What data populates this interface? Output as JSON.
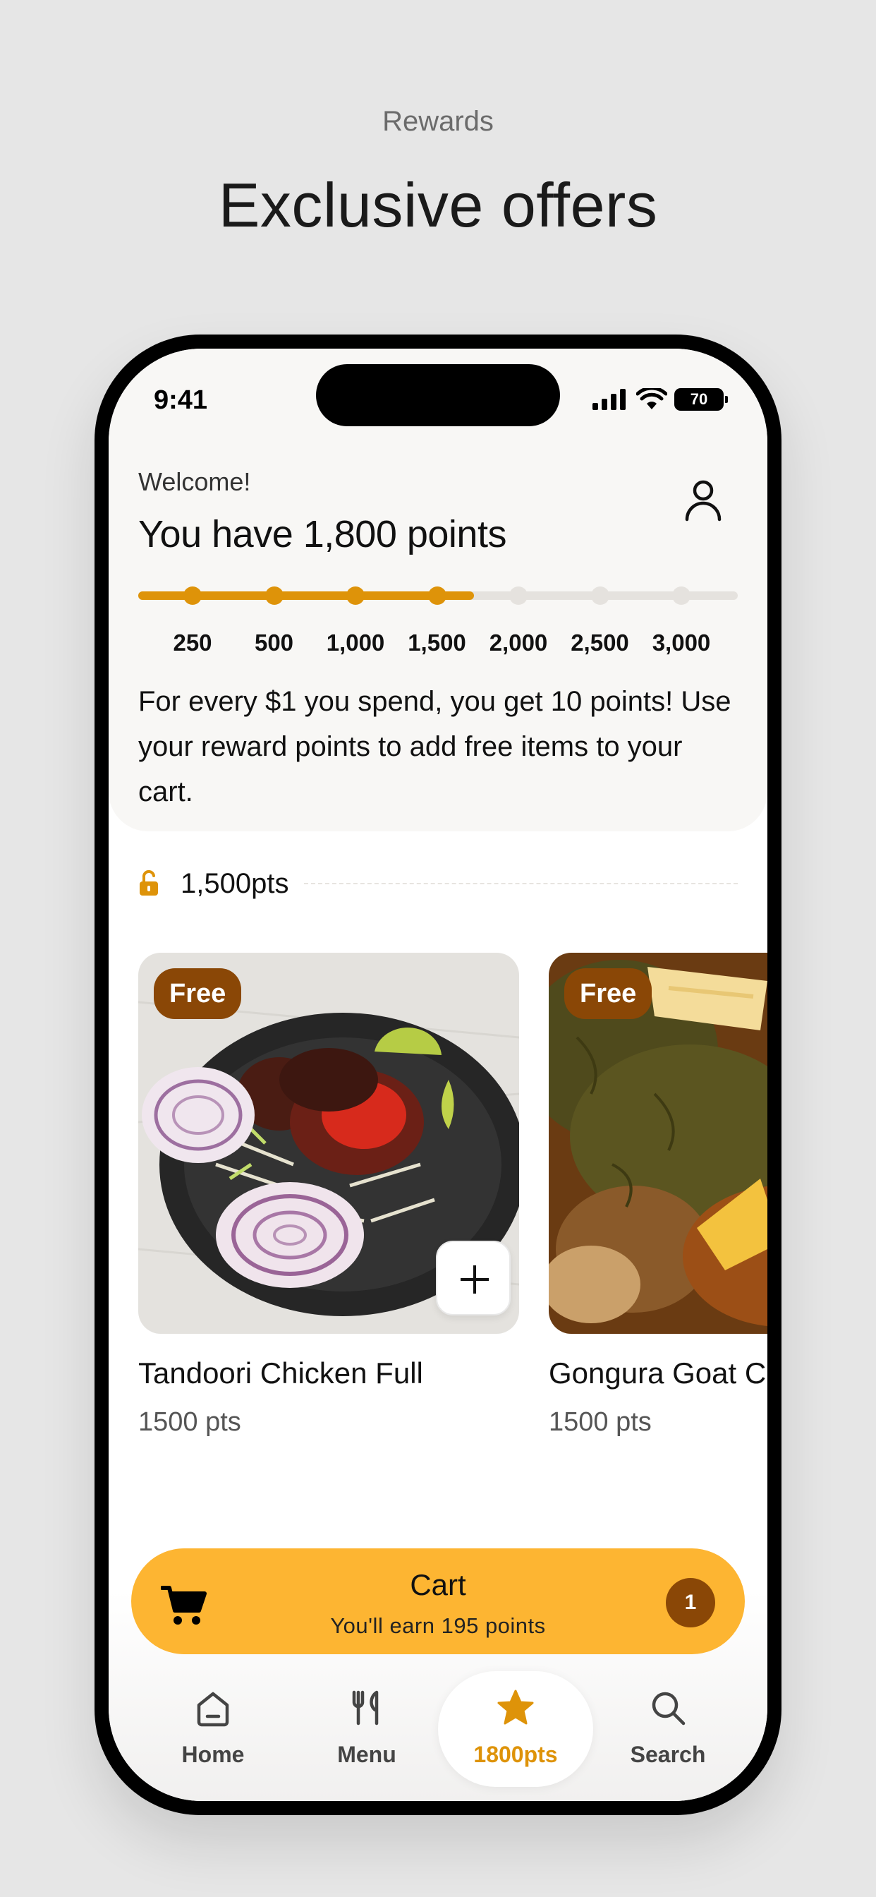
{
  "promo": {
    "eyebrow": "Rewards",
    "title": "Exclusive offers"
  },
  "status_bar": {
    "time": "9:41",
    "battery": "70",
    "icons": [
      "signal-icon",
      "wifi-icon",
      "battery-icon"
    ]
  },
  "header": {
    "welcome": "Welcome!",
    "points_title": "You have 1,800 points",
    "profile_icon": "person-icon"
  },
  "progress": {
    "current_points": 1800,
    "max_points": 3000,
    "fill_fraction": 0.56,
    "milestones": [
      {
        "label": "250",
        "reached": true
      },
      {
        "label": "500",
        "reached": true
      },
      {
        "label": "1,000",
        "reached": true
      },
      {
        "label": "1,500",
        "reached": true
      },
      {
        "label": "2,000",
        "reached": false
      },
      {
        "label": "2,500",
        "reached": false
      },
      {
        "label": "3,000",
        "reached": false
      }
    ]
  },
  "info_text": "For every $1 you spend, you get 10 points! Use your reward points to add free items to your cart.",
  "tier": {
    "label": "1,500pts",
    "icon": "unlocked-lock-icon"
  },
  "rewards": [
    {
      "badge": "Free",
      "name": "Tandoori Chicken Full",
      "points": "1500 pts"
    },
    {
      "badge": "Free",
      "name": "Gongura Goat Curry",
      "points": "1500 pts"
    }
  ],
  "cart": {
    "title": "Cart",
    "subtitle": "You'll earn 195 points",
    "count": "1",
    "icon": "cart-icon"
  },
  "tabs": [
    {
      "label": "Home",
      "icon": "home-icon",
      "active": false
    },
    {
      "label": "Menu",
      "icon": "utensils-icon",
      "active": false
    },
    {
      "label": "1800pts",
      "icon": "star-icon",
      "active": true
    },
    {
      "label": "Search",
      "icon": "search-icon",
      "active": false
    }
  ],
  "colors": {
    "accent": "#de9309",
    "cart_bg": "#fdb532",
    "badge_bg": "#8a4706",
    "page_bg": "#e6e6e6"
  }
}
